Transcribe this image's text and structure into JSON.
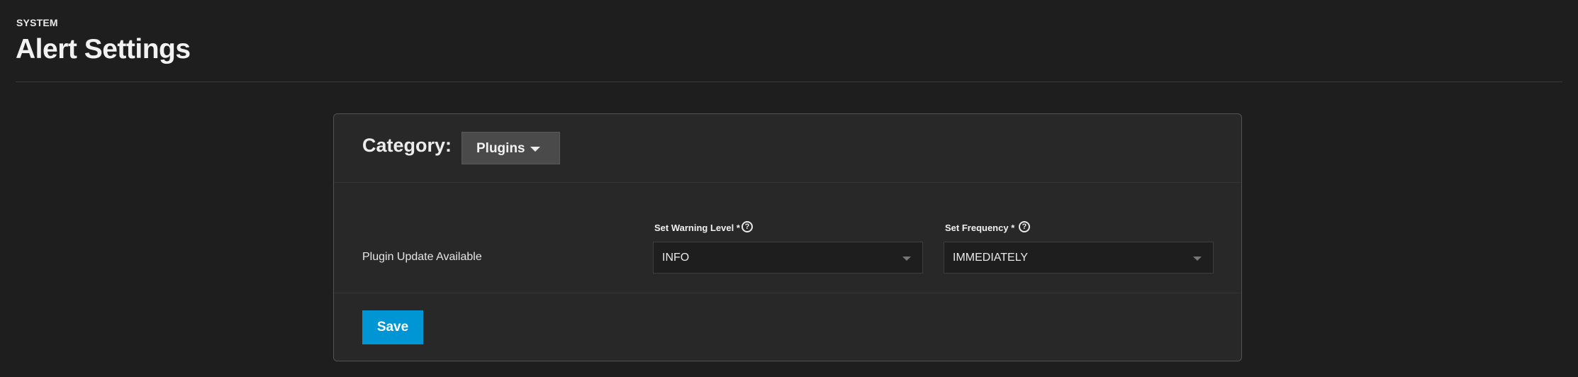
{
  "header": {
    "breadcrumb": "SYSTEM",
    "title": "Alert Settings"
  },
  "category": {
    "label": "Category:",
    "selected": "Plugins",
    "caret_icon": "caret-down-icon"
  },
  "alert_row": {
    "name": "Plugin Update Available",
    "warning_level": {
      "label": "Set Warning Level *",
      "help_icon": "help-circle-icon",
      "help_glyph": "?",
      "value": "INFO"
    },
    "frequency": {
      "label": "Set Frequency *",
      "help_icon": "help-circle-icon",
      "help_glyph": "?",
      "value": "IMMEDIATELY"
    }
  },
  "actions": {
    "save_label": "Save"
  },
  "colors": {
    "background": "#1e1e1e",
    "card": "#282828",
    "accent": "#0095d5"
  }
}
